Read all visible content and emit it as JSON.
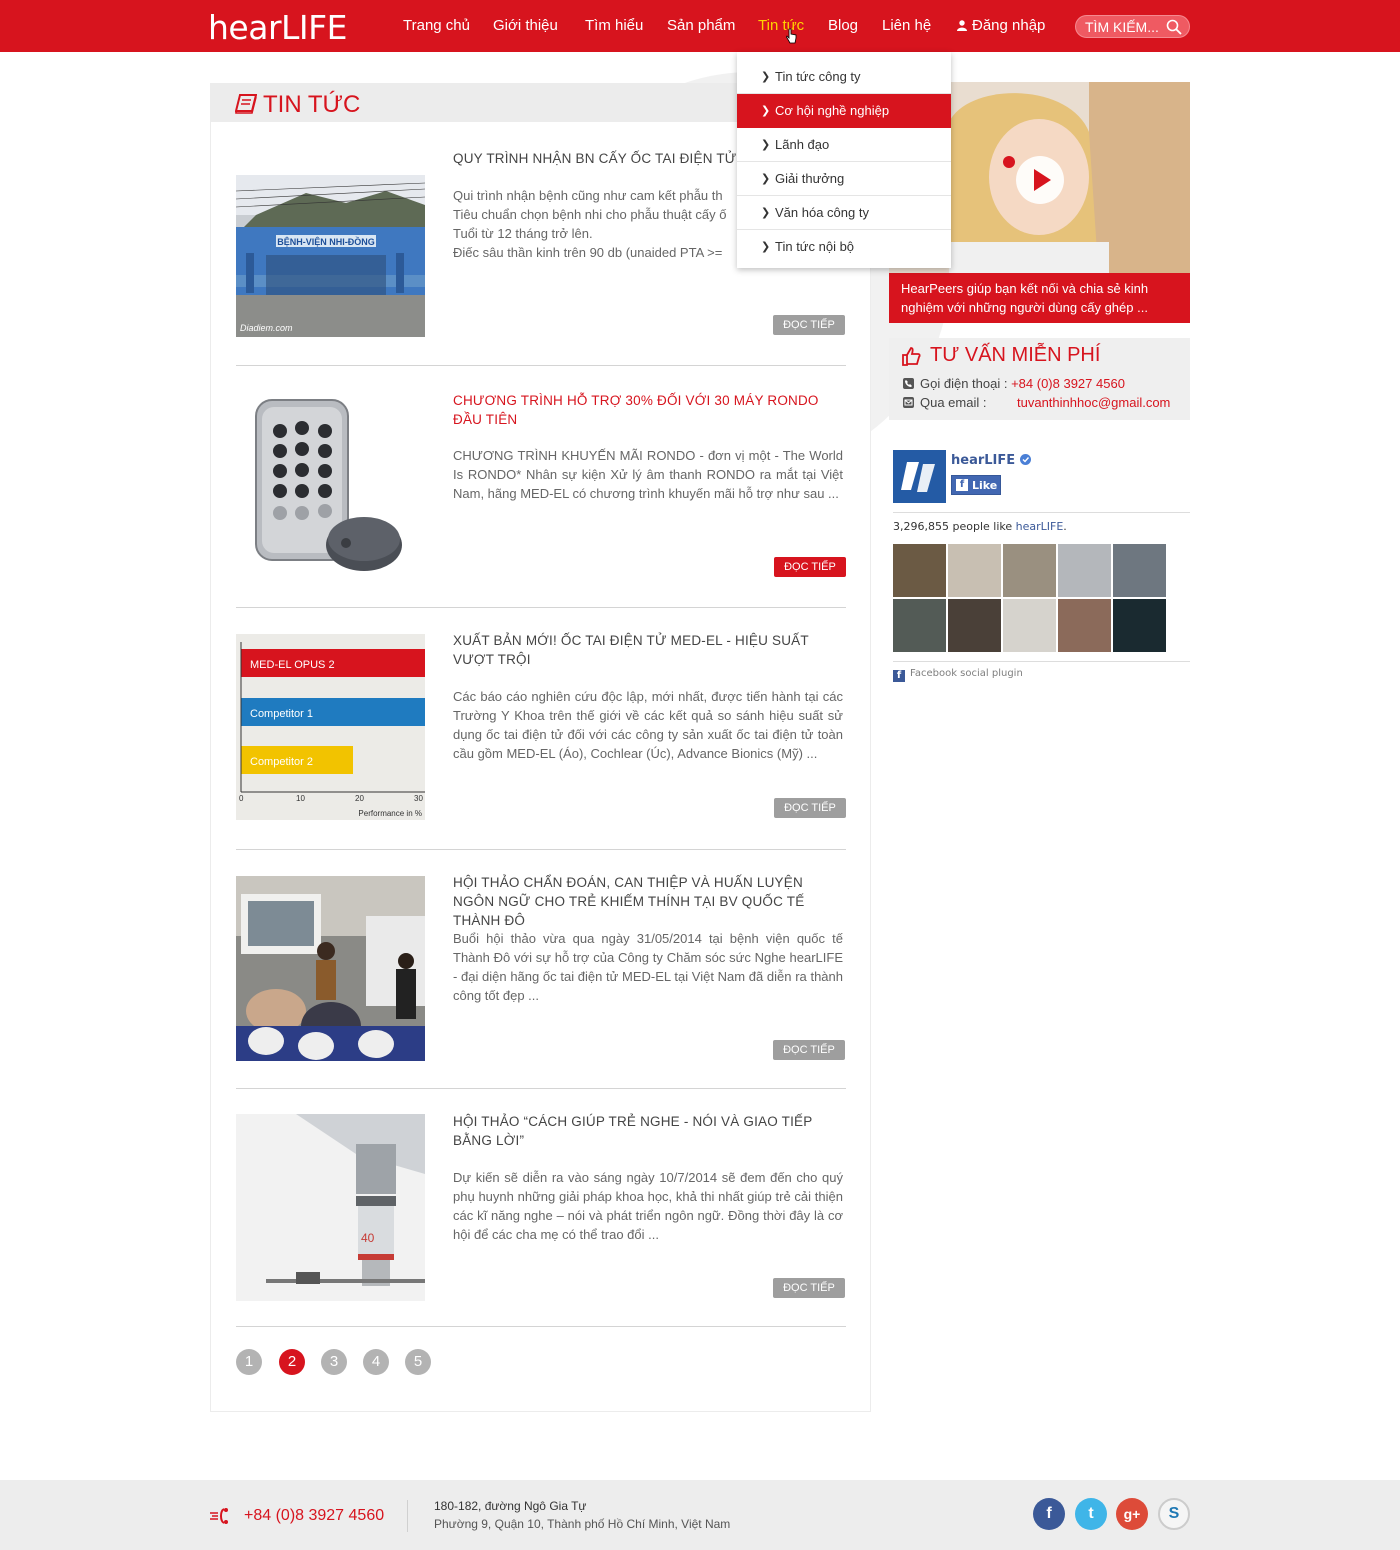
{
  "header": {
    "logo": "hearLIFE",
    "nav": [
      {
        "label": "Trang chủ"
      },
      {
        "label": "Giới thiệu"
      },
      {
        "label": "Tìm hiểu"
      },
      {
        "label": "Sản phẩm"
      },
      {
        "label": "Tin tức"
      },
      {
        "label": "Blog"
      },
      {
        "label": "Liên hệ"
      }
    ],
    "login_label": "Đăng nhập",
    "search_placeholder": "TÌM KIẾM...",
    "brand_color": "#d7141e",
    "active_nav_color": "#ffd200"
  },
  "dropdown": {
    "items": [
      {
        "label": "Tin tức công ty"
      },
      {
        "label": "Cơ hội nghề nghiệp"
      },
      {
        "label": "Lãnh đạo"
      },
      {
        "label": "Giải thưởng"
      },
      {
        "label": "Văn hóa công ty"
      },
      {
        "label": "Tin tức nội bộ"
      }
    ]
  },
  "main": {
    "title": "TIN TỨC",
    "articles": [
      {
        "title": "QUY TRÌNH NHẬN BN CẤY ỐC TAI ĐIỆN TỬ - B",
        "lines": [
          "Qui trình nhận bệnh cũng như cam kết phẫu th",
          "Tiêu chuẩn chọn bệnh nhi cho phẫu thuật cấy ố",
          "Tuổi từ 12 tháng trở lên.",
          "Điếc sâu thần kinh trên 90 db (unaided PTA >="
        ],
        "image_sign": "BỆNH-VIỆN NHI-ĐỒNG",
        "image_watermark": "Diadiem.com",
        "button": "ĐỌC TIẾP"
      },
      {
        "title": "CHƯƠNG TRÌNH HỖ TRỢ 30% ĐỐI VỚI 30 MÁY RONDO ĐẦU TIÊN",
        "body": " CHƯƠNG TRÌNH KHUYẾN MÃI RONDO - đơn vị một - The World Is RONDO* Nhân sự kiện Xử lý âm thanh RONDO ra mắt tại Việt Nam, hãng MED-EL có chương trình khuyến mãi hỗ trợ như sau ...",
        "button": "ĐỌC TIẾP"
      },
      {
        "title": "XUẤT BẢN MỚI! ỐC TAI ĐIỆN TỬ MED-EL - HIỆU SUẤT VƯỢT TRỘI",
        "body": "Các báo cáo nghiên cứu độc lập, mới nhất, được tiến hành tại các Trường Y Khoa trên thế giới về các kết quả so sánh hiệu suất sử dụng ốc tai điện tử đối với các công ty sản xuất ốc tai điện tử toàn cầu gồm MED-EL (Áo), Cochlear (Úc), Advance Bionics (Mỹ) ...",
        "button": "ĐỌC TIẾP",
        "chart_bars": [
          {
            "label": "MED-EL OPUS 2",
            "color": "#d7141e"
          },
          {
            "label": "Competitor 1",
            "color": "#1f7bc0"
          },
          {
            "label": "Competitor 2",
            "color": "#f2c300"
          }
        ],
        "chart_ticks": [
          "0",
          "10",
          "20",
          "30"
        ],
        "chart_axis_label": "Performance in %"
      },
      {
        "title": "HỘI THẢO CHẨN ĐOÁN, CAN THIỆP VÀ HUẤN LUYỆN NGÔN NGỮ CHO TRẺ KHIẾM THÍNH TẠI BV QUỐC TẾ THÀNH ĐÔ",
        "body": "Buổi hội thảo vừa qua ngày 31/05/2014 tại bệnh viện quốc tế Thành Đô với sự hỗ trợ của Công ty Chăm sóc sức Nghe hearLIFE - đại diện hãng ốc tai điện tử MED-EL tại Việt Nam đã diễn ra thành công tốt đẹp ...",
        "button": "ĐỌC TIẾP"
      },
      {
        "title": "HỘI THẢO “CÁCH GIÚP TRẺ NGHE - NÓI VÀ GIAO TIẾP BẰNG LỜI”",
        "body": "Dự kiến sẽ diễn ra vào sáng ngày 10/7/2014 sẽ đem đến cho quý phụ huynh những giải pháp khoa học, khả thi nhất giúp trẻ cải thiện các kĩ năng nghe – nói và phát triển ngôn ngữ. Đồng thời đây là cơ hội để các cha mẹ có thể trao đổi ...",
        "button": "ĐỌC TIẾP"
      }
    ],
    "pages": [
      "1",
      "2",
      "3",
      "4",
      "5"
    ],
    "current_page": "2"
  },
  "sidebar": {
    "video_caption": "HearPeers giúp bạn kết nối và chia sẻ kinh nghiệm với những người dùng cấy ghép ...",
    "consult_title": "TƯ VẤN MIỄN PHÍ",
    "phone_label": "Gọi điện thoại :",
    "phone_value": "+84 (0)8 3927 4560",
    "email_label": "Qua email :",
    "email_value": "tuvanthinhhoc@gmail.com",
    "fb_name": "hearLIFE",
    "fb_like": "Like",
    "fb_count": "3,296,855 people like",
    "fb_count_link": "hearLIFE",
    "fb_count_suffix": ".",
    "fb_plugin": "Facebook social plugin"
  },
  "footer": {
    "phone": "+84 (0)8 3927 4560",
    "address_line1": "180-182, đường Ngô Gia Tự",
    "address_line2": "Phường 9, Quận 10, Thành phố Hồ Chí Minh, Việt Nam",
    "social": [
      {
        "icon": "facebook-icon",
        "glyph": "f",
        "color": "#3b5998"
      },
      {
        "icon": "twitter-icon",
        "glyph": "t",
        "color": "#3fb5e8"
      },
      {
        "icon": "google-plus-icon",
        "glyph": "g+",
        "color": "#dd4b39"
      },
      {
        "icon": "skype-icon",
        "glyph": "S",
        "color": "#f5f5f5"
      }
    ]
  }
}
